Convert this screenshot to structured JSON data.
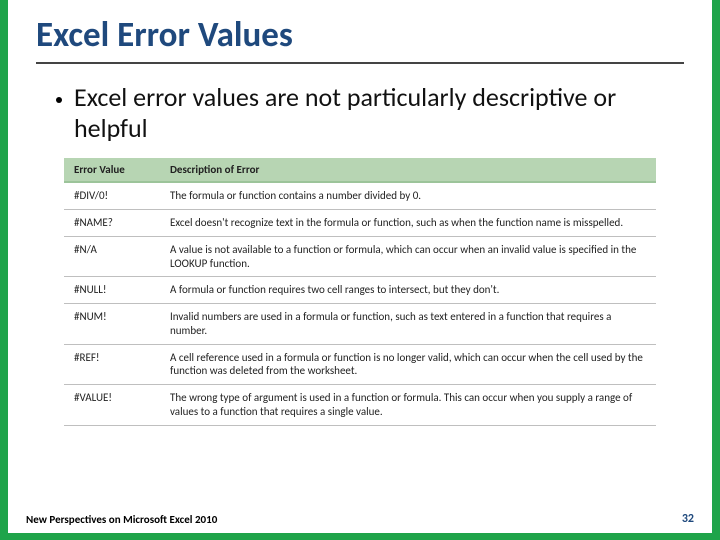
{
  "title": "Excel Error Values",
  "bullet": "Excel error values are not particularly descriptive or helpful",
  "table": {
    "headers": {
      "col1": "Error Value",
      "col2": "Description of Error"
    },
    "rows": [
      {
        "ev": "#DIV/0!",
        "desc": "The formula or function contains a number divided by 0."
      },
      {
        "ev": "#NAME?",
        "desc": "Excel doesn't recognize text in the formula or function, such as when the function name is misspelled."
      },
      {
        "ev": "#N/A",
        "desc": "A value is not available to a function or formula, which can occur when an invalid value is specified in the LOOKUP function."
      },
      {
        "ev": "#NULL!",
        "desc": "A formula or function requires two cell ranges to intersect, but they don't."
      },
      {
        "ev": "#NUM!",
        "desc": "Invalid numbers are used in a formula or function, such as text entered in a function that requires a number."
      },
      {
        "ev": "#REF!",
        "desc": "A cell reference used in a formula or function is no longer valid, which can occur when the cell used by the function was deleted from the worksheet."
      },
      {
        "ev": "#VALUE!",
        "desc": "The wrong type of argument is used in a function or formula. This can occur when you supply a range of values to a function that requires a single value."
      }
    ]
  },
  "footer": {
    "source": "New Perspectives on Microsoft Excel 2010",
    "page": "32"
  }
}
